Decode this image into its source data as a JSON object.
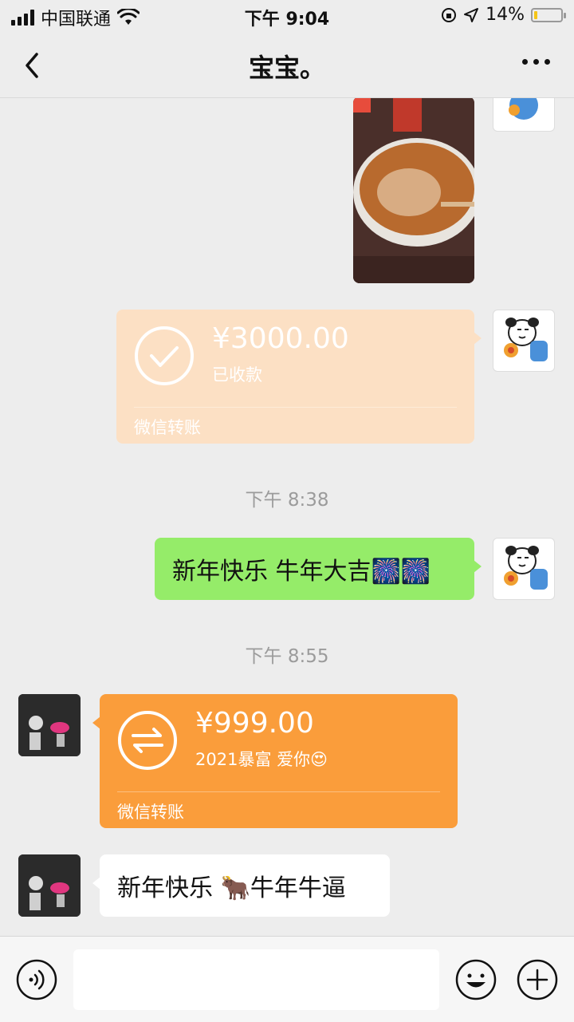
{
  "status_bar": {
    "carrier": "中国联通",
    "time": "下午 9:04",
    "battery": "14%",
    "battery_level": 0.14
  },
  "nav": {
    "title": "宝宝。"
  },
  "messages": {
    "transfer_received": {
      "amount": "¥3000.00",
      "status": "已收款",
      "footer": "微信转账",
      "color": "#fce0c4"
    },
    "timestamp_1": "下午 8:38",
    "greeting_sent": {
      "text": "新年快乐 牛年大吉🎆🎆",
      "color": "#95ec69"
    },
    "timestamp_2": "下午 8:55",
    "transfer_incoming": {
      "amount": "¥999.00",
      "note": "2021暴富 爱你😍",
      "footer": "微信转账",
      "color": "#fa9d3b"
    },
    "greeting_received": {
      "text": "新年快乐 🐂牛年牛逼",
      "color": "#ffffff"
    }
  },
  "input_bar": {
    "placeholder": ""
  }
}
